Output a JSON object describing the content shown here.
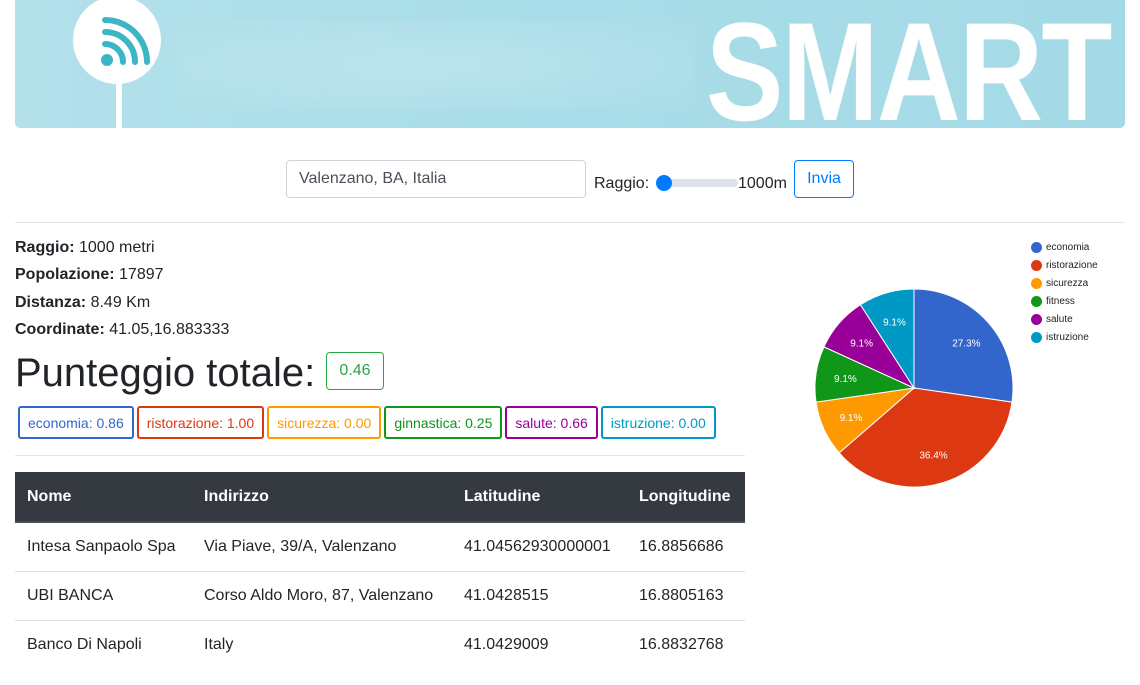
{
  "banner": {
    "brand": "SMART"
  },
  "search": {
    "value": "Valenzano, BA, Italia",
    "radius_label": "Raggio:",
    "radius_value": "1000m",
    "submit_label": "Invia",
    "radius_fraction": 0.0
  },
  "info": [
    {
      "label": "Raggio:",
      "value": "1000 metri"
    },
    {
      "label": "Popolazione:",
      "value": "17897"
    },
    {
      "label": "Distanza:",
      "value": "8.49 Km"
    },
    {
      "label": "Coordinate:",
      "value": "41.05,16.883333"
    }
  ],
  "score": {
    "title": "Punteggio totale:",
    "value": "0.46"
  },
  "categories": [
    {
      "label": "economia: 0.86",
      "color": "#3366cc"
    },
    {
      "label": "ristorazione: 1.00",
      "color": "#dc3912"
    },
    {
      "label": "sicurezza: 0.00",
      "color": "#ff9900"
    },
    {
      "label": "ginnastica: 0.25",
      "color": "#109618"
    },
    {
      "label": "salute: 0.66",
      "color": "#990099"
    },
    {
      "label": "istruzione: 0.00",
      "color": "#0099c6"
    }
  ],
  "table": {
    "headers": [
      "Nome",
      "Indirizzo",
      "Latitudine",
      "Longitudine"
    ],
    "rows": [
      [
        "Intesa Sanpaolo Spa",
        "Via Piave, 39/A, Valenzano",
        "41.04562930000001",
        "16.8856686"
      ],
      [
        "UBI BANCA",
        "Corso Aldo Moro, 87, Valenzano",
        "41.0428515",
        "16.8805163"
      ],
      [
        "Banco Di Napoli",
        "Italy",
        "41.0429009",
        "16.8832768"
      ]
    ]
  },
  "chart_data": {
    "type": "pie",
    "categories": [
      "economia",
      "ristorazione",
      "sicurezza",
      "fitness",
      "salute",
      "istruzione"
    ],
    "values": [
      27.3,
      36.4,
      9.1,
      9.1,
      9.1,
      9.1
    ],
    "labels": [
      "27.3%",
      "36.4%",
      "9.1%",
      "9.1%",
      "9.1%",
      "9.1%"
    ],
    "colors": [
      "#3366cc",
      "#dc3912",
      "#ff9900",
      "#109618",
      "#990099",
      "#0099c6"
    ],
    "legend_position": "right"
  }
}
